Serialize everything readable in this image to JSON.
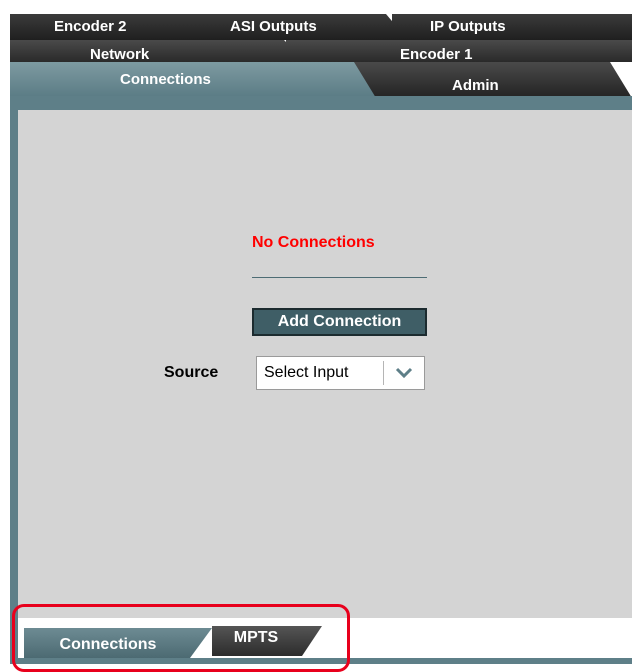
{
  "tabs": {
    "row1": [
      "Encoder 2",
      "ASI Outputs",
      "IP Outputs"
    ],
    "row2": [
      "Network",
      "Encoder 1"
    ],
    "row3_active": "Connections",
    "row3_other": "Admin"
  },
  "main": {
    "status": "No Connections",
    "add_button": "Add Connection",
    "source_label": "Source",
    "source_select_value": "Select Input"
  },
  "bottom_tabs": {
    "active": "Connections",
    "other": "MPTS"
  },
  "colors": {
    "status_text": "#ff0000",
    "accent_teal": "#5e7f88",
    "highlight_border": "#e8001c"
  }
}
